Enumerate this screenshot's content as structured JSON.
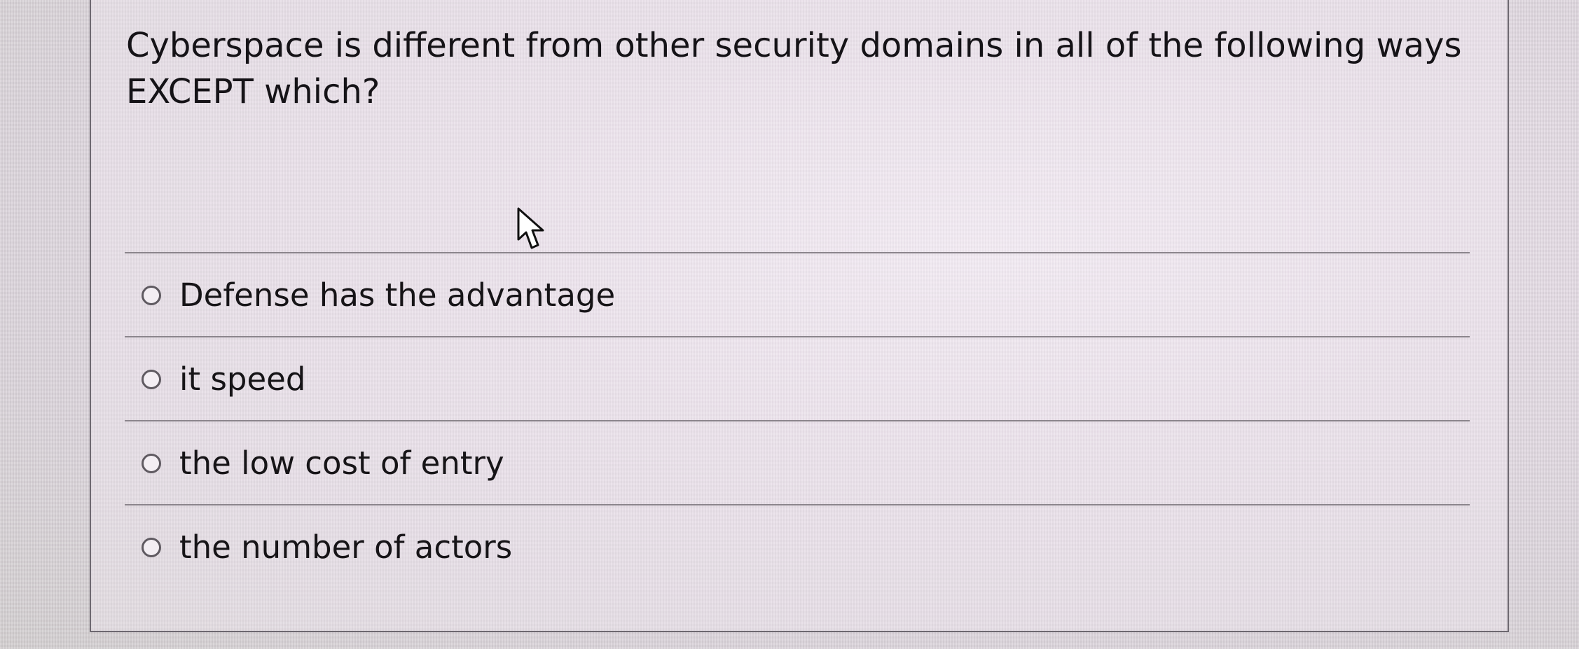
{
  "question": {
    "text": "Cyberspace is different from other security domains in all of the following ways EXCEPT which?"
  },
  "answers": [
    {
      "label": "Defense has the advantage",
      "selected": false
    },
    {
      "label": "it speed",
      "selected": false
    },
    {
      "label": "the low cost of entry",
      "selected": false
    },
    {
      "label": "the number of actors",
      "selected": false
    }
  ],
  "cursor": {
    "icon": "mouse-pointer-icon"
  }
}
